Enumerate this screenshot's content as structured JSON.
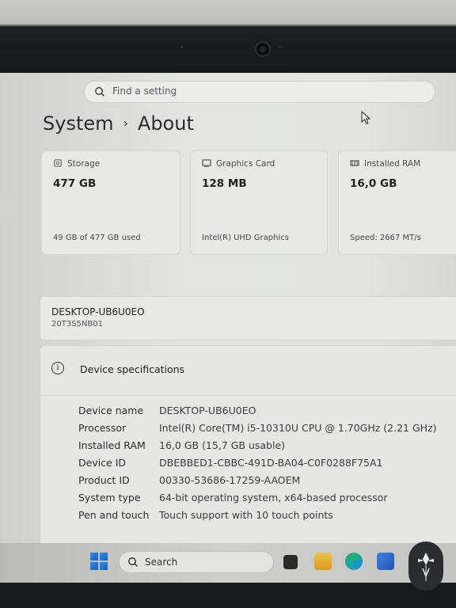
{
  "search": {
    "placeholder": "Find a setting"
  },
  "breadcrumb": {
    "parent": "System",
    "separator": "›",
    "current": "About"
  },
  "cards": [
    {
      "icon": "storage-icon",
      "label": "Storage",
      "value": "477 GB",
      "sub": "49 GB of 477 GB used"
    },
    {
      "icon": "graphics-card-icon",
      "label": "Graphics Card",
      "value": "128 MB",
      "sub": "Intel(R) UHD Graphics"
    },
    {
      "icon": "ram-icon",
      "label": "Installed RAM",
      "value": "16,0 GB",
      "sub": "Speed: 2667 MT/s"
    }
  ],
  "device": {
    "name": "DESKTOP-UB6U0EO",
    "model": "20T3S5NB01"
  },
  "specs": {
    "title": "Device specifications",
    "rows": [
      {
        "label": "Device name",
        "value": "DESKTOP-UB6U0EO"
      },
      {
        "label": "Processor",
        "value": "Intel(R) Core(TM) i5-10310U CPU @ 1.70GHz (2.21 GHz)"
      },
      {
        "label": "Installed RAM",
        "value": "16,0 GB (15,7 GB usable)"
      },
      {
        "label": "Device ID",
        "value": "DBEBBED1-CBBC-491D-BA04-C0F0288F75A1"
      },
      {
        "label": "Product ID",
        "value": "00330-53686-17259-AAOEM"
      },
      {
        "label": "System type",
        "value": "64-bit operating system, x64-based processor"
      },
      {
        "label": "Pen and touch",
        "value": "Touch support with 10 touch points"
      }
    ]
  },
  "taskbar": {
    "search_label": "Search"
  },
  "colors": {
    "windows_blue": "#1b6fd4",
    "edge": "#1aa6a0",
    "explorer": "#e8b030",
    "store": "#2f6fd0"
  }
}
